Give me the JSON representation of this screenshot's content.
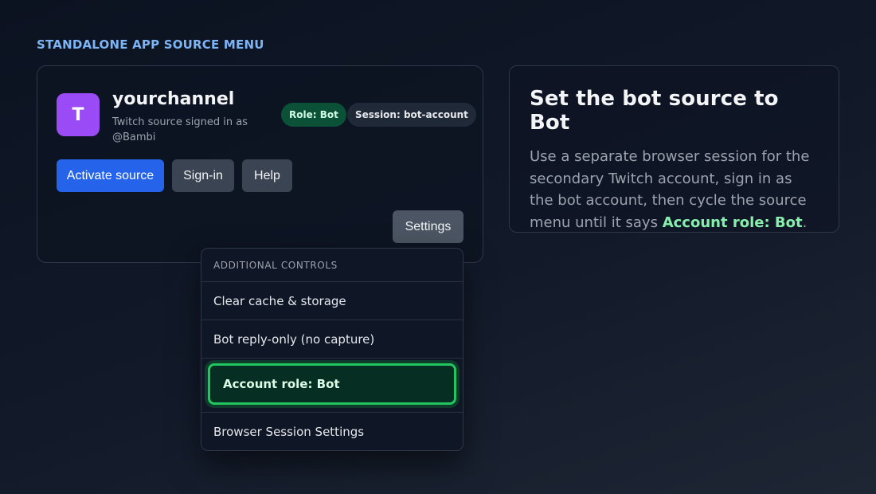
{
  "section_label": "STANDALONE APP SOURCE MENU",
  "source_card": {
    "avatar_letter": "T",
    "channel_name": "yourchannel",
    "subtitle": "Twitch source signed in as @Bambi",
    "role_pill": "Role: Bot",
    "session_pill": "Session: bot-account",
    "buttons": {
      "activate": "Activate source",
      "signin": "Sign-in",
      "help": "Help",
      "settings": "Settings"
    }
  },
  "dropdown": {
    "header": "ADDITIONAL CONTROLS",
    "items": [
      "Clear cache & storage",
      "Bot reply-only (no capture)",
      "Account role: Bot",
      "Browser Session Settings"
    ],
    "active_index": 2
  },
  "info_card": {
    "title": "Set the bot source to Bot",
    "body_text": "Use a separate browser session for the secondary Twitch account, sign in as the bot account, then cycle the source menu until it says ",
    "highlight": "Account role: Bot",
    "body_end": "."
  },
  "colors": {
    "accent_blue": "#2563eb",
    "active_green": "#22c55e",
    "avatar_purple": "#9b4bf5"
  }
}
